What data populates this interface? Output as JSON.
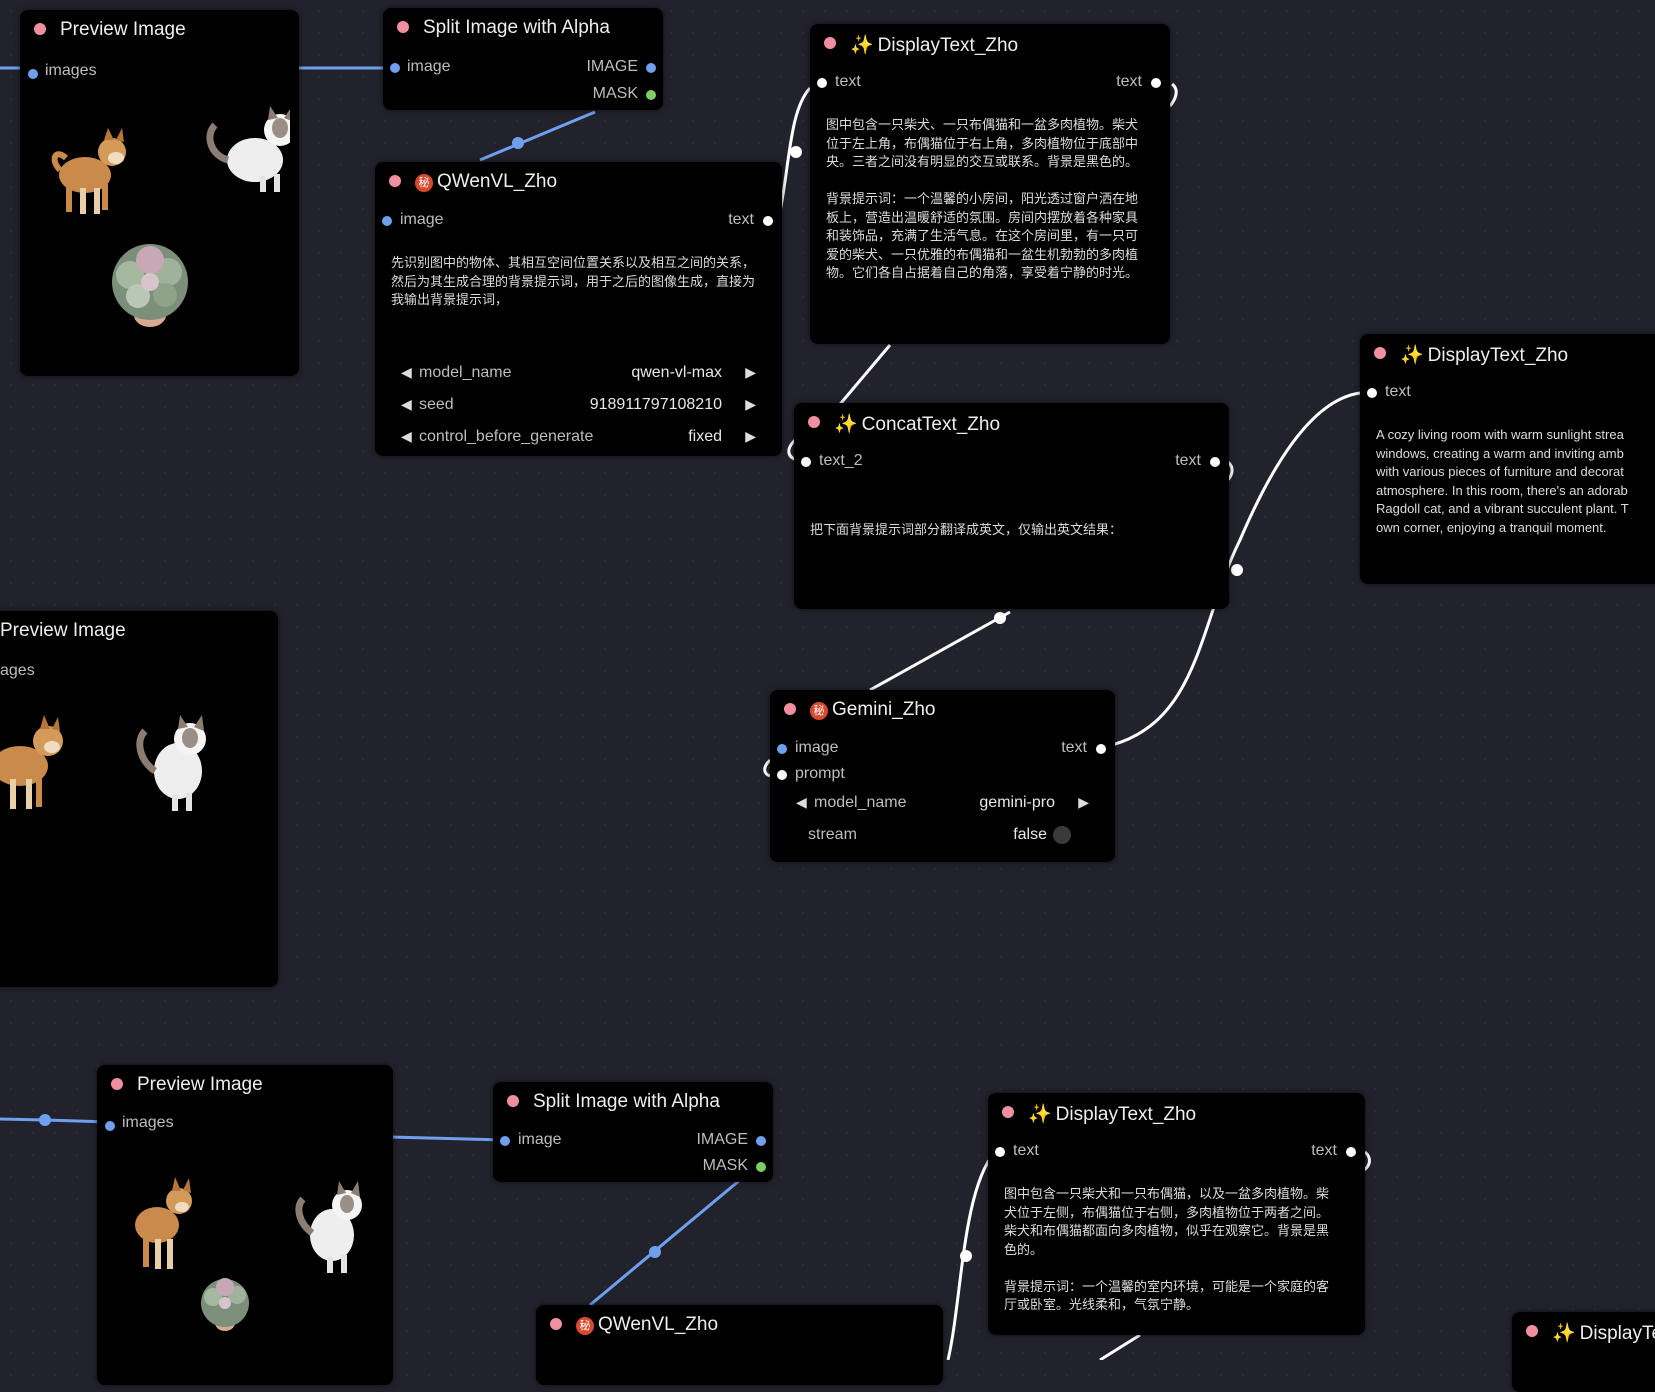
{
  "nodes": {
    "preview1": {
      "title": "Preview Image",
      "input": "images"
    },
    "split1": {
      "title": "Split Image with Alpha",
      "input": "image",
      "out_image": "IMAGE",
      "out_mask": "MASK"
    },
    "qwen1": {
      "badge": "秘",
      "title": "QWenVL_Zho",
      "input": "image",
      "output": "text",
      "prompt": "先识别图中的物体、其相互空间位置关系以及相互之间的关系，\n然后为其生成合理的背景提示词，用于之后的图像生成，直接为\n我输出背景提示词，",
      "widgets": [
        {
          "label": "model_name",
          "value": "qwen-vl-max"
        },
        {
          "label": "seed",
          "value": "918911797108210"
        },
        {
          "label": "control_before_generate",
          "value": "fixed"
        }
      ]
    },
    "display1": {
      "spark": "✨",
      "title": "DisplayText_Zho",
      "input": "text",
      "output": "text",
      "content": "图中包含一只柴犬、一只布偶猫和一盆多肉植物。柴犬\n位于左上角，布偶猫位于右上角，多肉植物位于底部中\n央。三者之间没有明显的交互或联系。背景是黑色的。\n\n背景提示词：一个温馨的小房间，阳光透过窗户洒在地\n板上，营造出温暖舒适的氛围。房间内摆放着各种家具\n和装饰品，充满了生活气息。在这个房间里，有一只可\n爱的柴犬、一只优雅的布偶猫和一盆生机勃勃的多肉植\n物。它们各自占据着自己的角落，享受着宁静的时光。"
    },
    "display2": {
      "spark": "✨",
      "title": "DisplayText_Zho",
      "input": "text",
      "content": "A cozy living room with warm sunlight strea\nwindows, creating a warm and inviting amb\nwith various pieces of furniture and decorat\natmosphere. In this room, there's an adorab\nRagdoll cat, and a vibrant succulent plant. T\nown corner, enjoying a tranquil moment."
    },
    "concat": {
      "spark": "✨",
      "title": "ConcatText_Zho",
      "input": "text_2",
      "output": "text",
      "content": "把下面背景提示词部分翻译成英文，仅输出英文结果："
    },
    "gemini": {
      "badge": "秘",
      "title": "Gemini_Zho",
      "in_image": "image",
      "in_prompt": "prompt",
      "output": "text",
      "model_label": "model_name",
      "model_value": "gemini-pro",
      "stream_label": "stream",
      "stream_value": "false"
    },
    "preview2": {
      "title": "Preview Image",
      "input": "ages"
    },
    "preview3": {
      "title": "Preview Image",
      "input": "images"
    },
    "split2": {
      "title": "Split Image with Alpha",
      "input": "image",
      "out_image": "IMAGE",
      "out_mask": "MASK"
    },
    "display3": {
      "spark": "✨",
      "title": "DisplayText_Zho",
      "input": "text",
      "output": "text",
      "content": "图中包含一只柴犬和一只布偶猫，以及一盆多肉植物。柴\n犬位于左侧，布偶猫位于右侧，多肉植物位于两者之间。\n柴犬和布偶猫都面向多肉植物，似乎在观察它。背景是黑\n色的。\n\n背景提示词：一个温馨的室内环境，可能是一个家庭的客\n厅或卧室。光线柔和，气氛宁静。"
    },
    "qwen2": {
      "badge": "秘",
      "title": "QWenVL_Zho"
    },
    "display4": {
      "spark": "✨",
      "title": "DisplayTe"
    }
  },
  "colors": {
    "background": "#22222c",
    "node_bg": "#000000",
    "image_link": "#6fa0f0",
    "text_link": "#ffffff",
    "title_dot": "#f08fa0"
  }
}
